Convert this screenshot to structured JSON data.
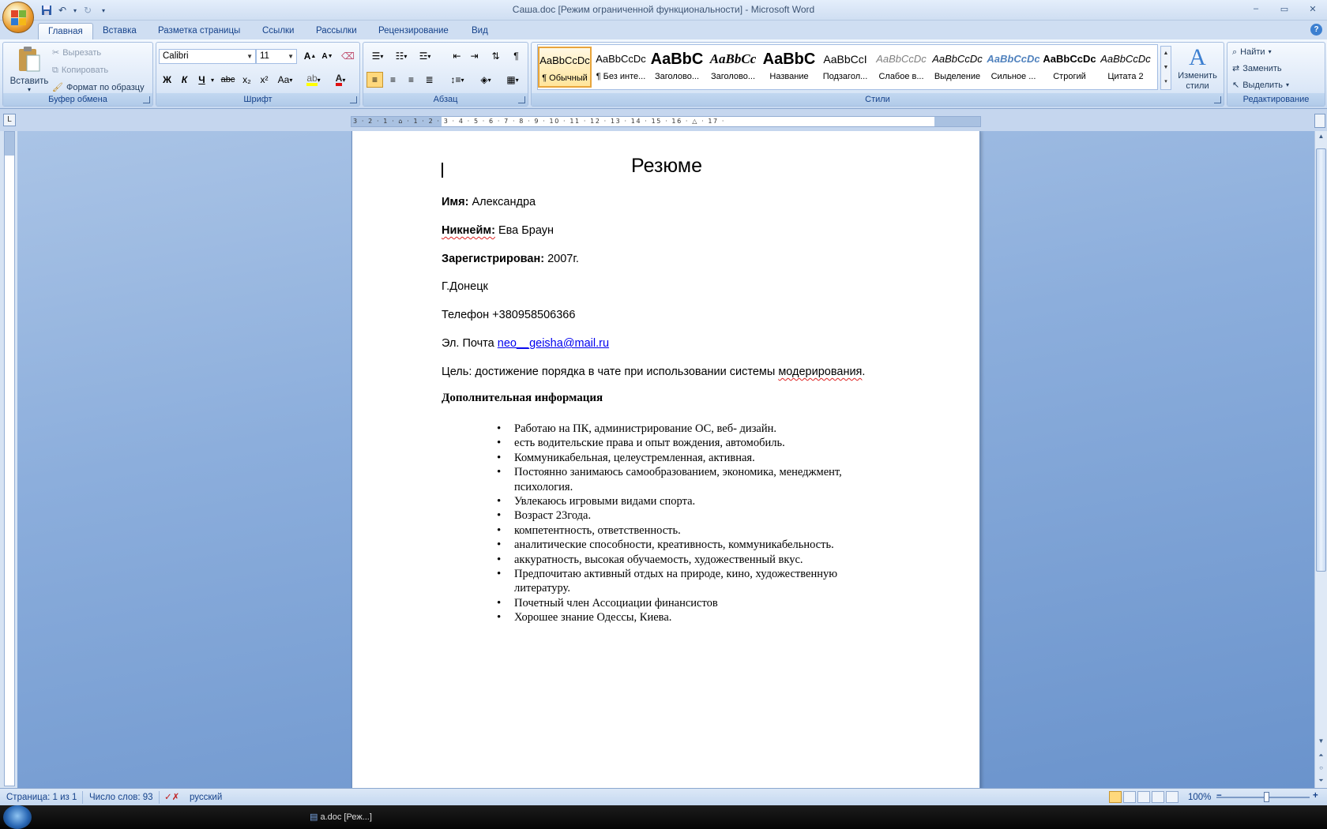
{
  "window": {
    "title": "Саша.doc [Режим ограниченной функциональности] - Microsoft Word",
    "minimize": "‒",
    "restore": "▭",
    "close": "✕"
  },
  "tabs": [
    {
      "label": "Главная",
      "active": true
    },
    {
      "label": "Вставка"
    },
    {
      "label": "Разметка страницы"
    },
    {
      "label": "Ссылки"
    },
    {
      "label": "Рассылки"
    },
    {
      "label": "Рецензирование"
    },
    {
      "label": "Вид"
    }
  ],
  "clipboard": {
    "group": "Буфер обмена",
    "paste": "Вставить",
    "cut": "Вырезать",
    "copy": "Копировать",
    "format_painter": "Формат по образцу"
  },
  "font": {
    "group": "Шрифт",
    "name": "Calibri",
    "size": "11",
    "bold": "Ж",
    "italic": "К",
    "underline": "Ч",
    "strike": "abc",
    "subscript": "x₂",
    "superscript": "x²",
    "case": "Aa",
    "grow": "A",
    "shrink": "A"
  },
  "paragraph": {
    "group": "Абзац"
  },
  "styles": {
    "group": "Стили",
    "change_styles": "Изменить стили",
    "items": [
      {
        "sample": "AaBbCcDc",
        "name": "¶ Обычный",
        "selected": true
      },
      {
        "sample": "AaBbCcDc",
        "name": "¶ Без инте..."
      },
      {
        "sample": "AaBbC",
        "name": "Заголово..."
      },
      {
        "sample": "AaBbCc",
        "name": "Заголово..."
      },
      {
        "sample": "AaBbC",
        "name": "Название"
      },
      {
        "sample": "AaBbCcI",
        "name": "Подзагол..."
      },
      {
        "sample": "AaBbCcDc",
        "name": "Слабое в..."
      },
      {
        "sample": "AaBbCcDc",
        "name": "Выделение"
      },
      {
        "sample": "AaBbCcDc",
        "name": "Сильное ..."
      },
      {
        "sample": "AaBbCcDc",
        "name": "Строгий"
      },
      {
        "sample": "AaBbCcDc",
        "name": "Цитата 2"
      }
    ]
  },
  "editing": {
    "group": "Редактирование",
    "find": "Найти",
    "replace": "Заменить",
    "select": "Выделить"
  },
  "ruler": {
    "numbers": "3 · 2 · 1 · ⌂ · 1 · 2 · 3 · 4 · 5 · 6 · 7 · 8 · 9 · 10 · 11 · 12 · 13 · 14 · 15 · 16 · △ · 17 ·"
  },
  "document": {
    "title": "Резюме",
    "name_label": "Имя:",
    "name_value": " Александра",
    "nick_label": "Никнейм:",
    "nick_value": " Ева Браун",
    "reg_label": "Зарегистрирован:",
    "reg_value": " 2007г.",
    "city": "Г.Донецк",
    "phone": "Телефон +380958506366",
    "email_label": "Эл. Почта ",
    "email_link": "neo__geisha@mail.ru",
    "goal_prefix": "Цель: достижение порядка в чате при использовании системы ",
    "goal_word": "модерирования",
    "goal_suffix": ".",
    "extra_heading": "Дополнительная информация",
    "bullets": [
      "Работаю на ПК, администрирование  ОС, веб- дизайн.",
      "есть водительские права и опыт вождения, автомобиль.",
      "Коммуникабельная, целеустремленная, активная.",
      "Постоянно занимаюсь самообразованием, экономика, менеджмент, психология.",
      "Увлекаюсь игровыми видами спорта.",
      "Возраст 23года.",
      "компетентность, ответственность.",
      " аналитические способности, креативность, коммуникабельность.",
      " аккуратность, высокая обучаемость, художественный вкус.",
      "Предпочитаю активный отдых на природе, кино, художественную литературу.",
      "Почетный член Ассоциации финансистов",
      "Хорошее знание Одессы, Киева."
    ]
  },
  "status": {
    "page": "Страница: 1 из 1",
    "words": "Число слов: 93",
    "language": "русский",
    "zoom": "100%"
  },
  "taskbar": {
    "item1": "a.doc [Реж...]"
  },
  "colors": {
    "accent": "#15428b",
    "ribbon": "#dbe7f7",
    "workspace": "#6a93cc",
    "link": "#0000ee",
    "spell_error": "#dd2222"
  }
}
